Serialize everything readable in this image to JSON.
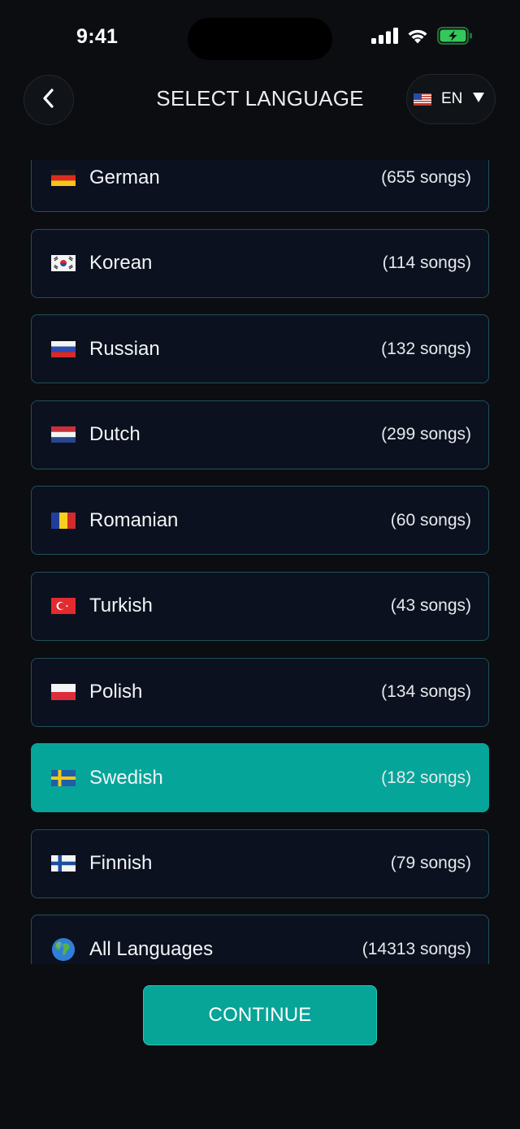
{
  "status_bar": {
    "time": "9:41",
    "icons": [
      "cellular-signal-icon",
      "wifi-icon",
      "battery-charging-icon"
    ],
    "battery_color": "#34c759"
  },
  "header": {
    "back_icon": "chevron-left-icon",
    "title": "SELECT LANGUAGE",
    "language_selector": {
      "flag": "us-flag-icon",
      "code": "EN",
      "dropdown_icon": "triangle-down-icon"
    }
  },
  "languages": [
    {
      "name": "German",
      "count": "(655 songs)",
      "flag": "germany-flag-icon",
      "selected": false
    },
    {
      "name": "Korean",
      "count": "(114 songs)",
      "flag": "south-korea-flag-icon",
      "selected": false
    },
    {
      "name": "Russian",
      "count": "(132 songs)",
      "flag": "russia-flag-icon",
      "selected": false
    },
    {
      "name": "Dutch",
      "count": "(299 songs)",
      "flag": "netherlands-flag-icon",
      "selected": false
    },
    {
      "name": "Romanian",
      "count": "(60 songs)",
      "flag": "romania-flag-icon",
      "selected": false
    },
    {
      "name": "Turkish",
      "count": "(43 songs)",
      "flag": "turkey-flag-icon",
      "selected": false
    },
    {
      "name": "Polish",
      "count": "(134 songs)",
      "flag": "poland-flag-icon",
      "selected": false
    },
    {
      "name": "Swedish",
      "count": "(182 songs)",
      "flag": "sweden-flag-icon",
      "selected": true
    },
    {
      "name": "Finnish",
      "count": "(79 songs)",
      "flag": "finland-flag-icon",
      "selected": false
    },
    {
      "name": "All Languages",
      "count": "(14313 songs)",
      "flag": "globe-icon",
      "selected": false
    }
  ],
  "continue_label": "CONTINUE",
  "colors": {
    "background": "#0b0d11",
    "row_background": "#0c1120",
    "row_border": "#1f5159",
    "accent": "#06a59a"
  }
}
